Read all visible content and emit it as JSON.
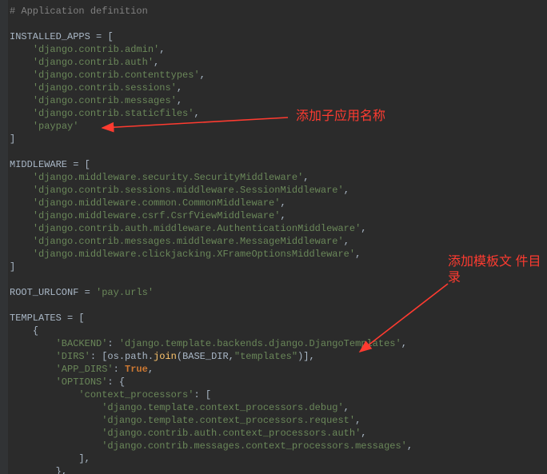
{
  "comment_header": "# Application definition",
  "installed_apps_var": "INSTALLED_APPS",
  "eq": "=",
  "lbr": "[",
  "rbr": "]",
  "lbrace": "{",
  "rbrace": "}",
  "comma": ",",
  "installed_apps": [
    "'django.contrib.admin'",
    "'django.contrib.auth'",
    "'django.contrib.contenttypes'",
    "'django.contrib.sessions'",
    "'django.contrib.messages'",
    "'django.contrib.staticfiles'",
    "'paypay'"
  ],
  "middleware_var": "MIDDLEWARE",
  "middleware": [
    "'django.middleware.security.SecurityMiddleware'",
    "'django.contrib.sessions.middleware.SessionMiddleware'",
    "'django.middleware.common.CommonMiddleware'",
    "'django.middleware.csrf.CsrfViewMiddleware'",
    "'django.contrib.auth.middleware.AuthenticationMiddleware'",
    "'django.contrib.messages.middleware.MessageMiddleware'",
    "'django.middleware.clickjacking.XFrameOptionsMiddleware'"
  ],
  "root_urlconf_var": "ROOT_URLCONF",
  "root_urlconf_val": "'pay.urls'",
  "templates_var": "TEMPLATES",
  "backend_key": "'BACKEND'",
  "backend_val": "'django.template.backends.django.DjangoTemplates'",
  "dirs_key": "'DIRS'",
  "dirs_prefix": "[os.path.",
  "dirs_join": "join",
  "dirs_args_open": "(",
  "dirs_base": "BASE_DIR",
  "dirs_comma": ",",
  "dirs_str": "\"templates\"",
  "dirs_close": ")],",
  "app_dirs_key": "'APP_DIRS'",
  "app_dirs_val": "True",
  "options_key": "'OPTIONS'",
  "ctx_key": "'context_processors'",
  "ctx_list": [
    "'django.template.context_processors.debug'",
    "'django.template.context_processors.request'",
    "'django.contrib.auth.context_processors.auth'",
    "'django.contrib.messages.context_processors.messages'"
  ],
  "colon": ":",
  "annotation1": "添加子应用名称",
  "annotation2": "添加模板文\n件目录"
}
